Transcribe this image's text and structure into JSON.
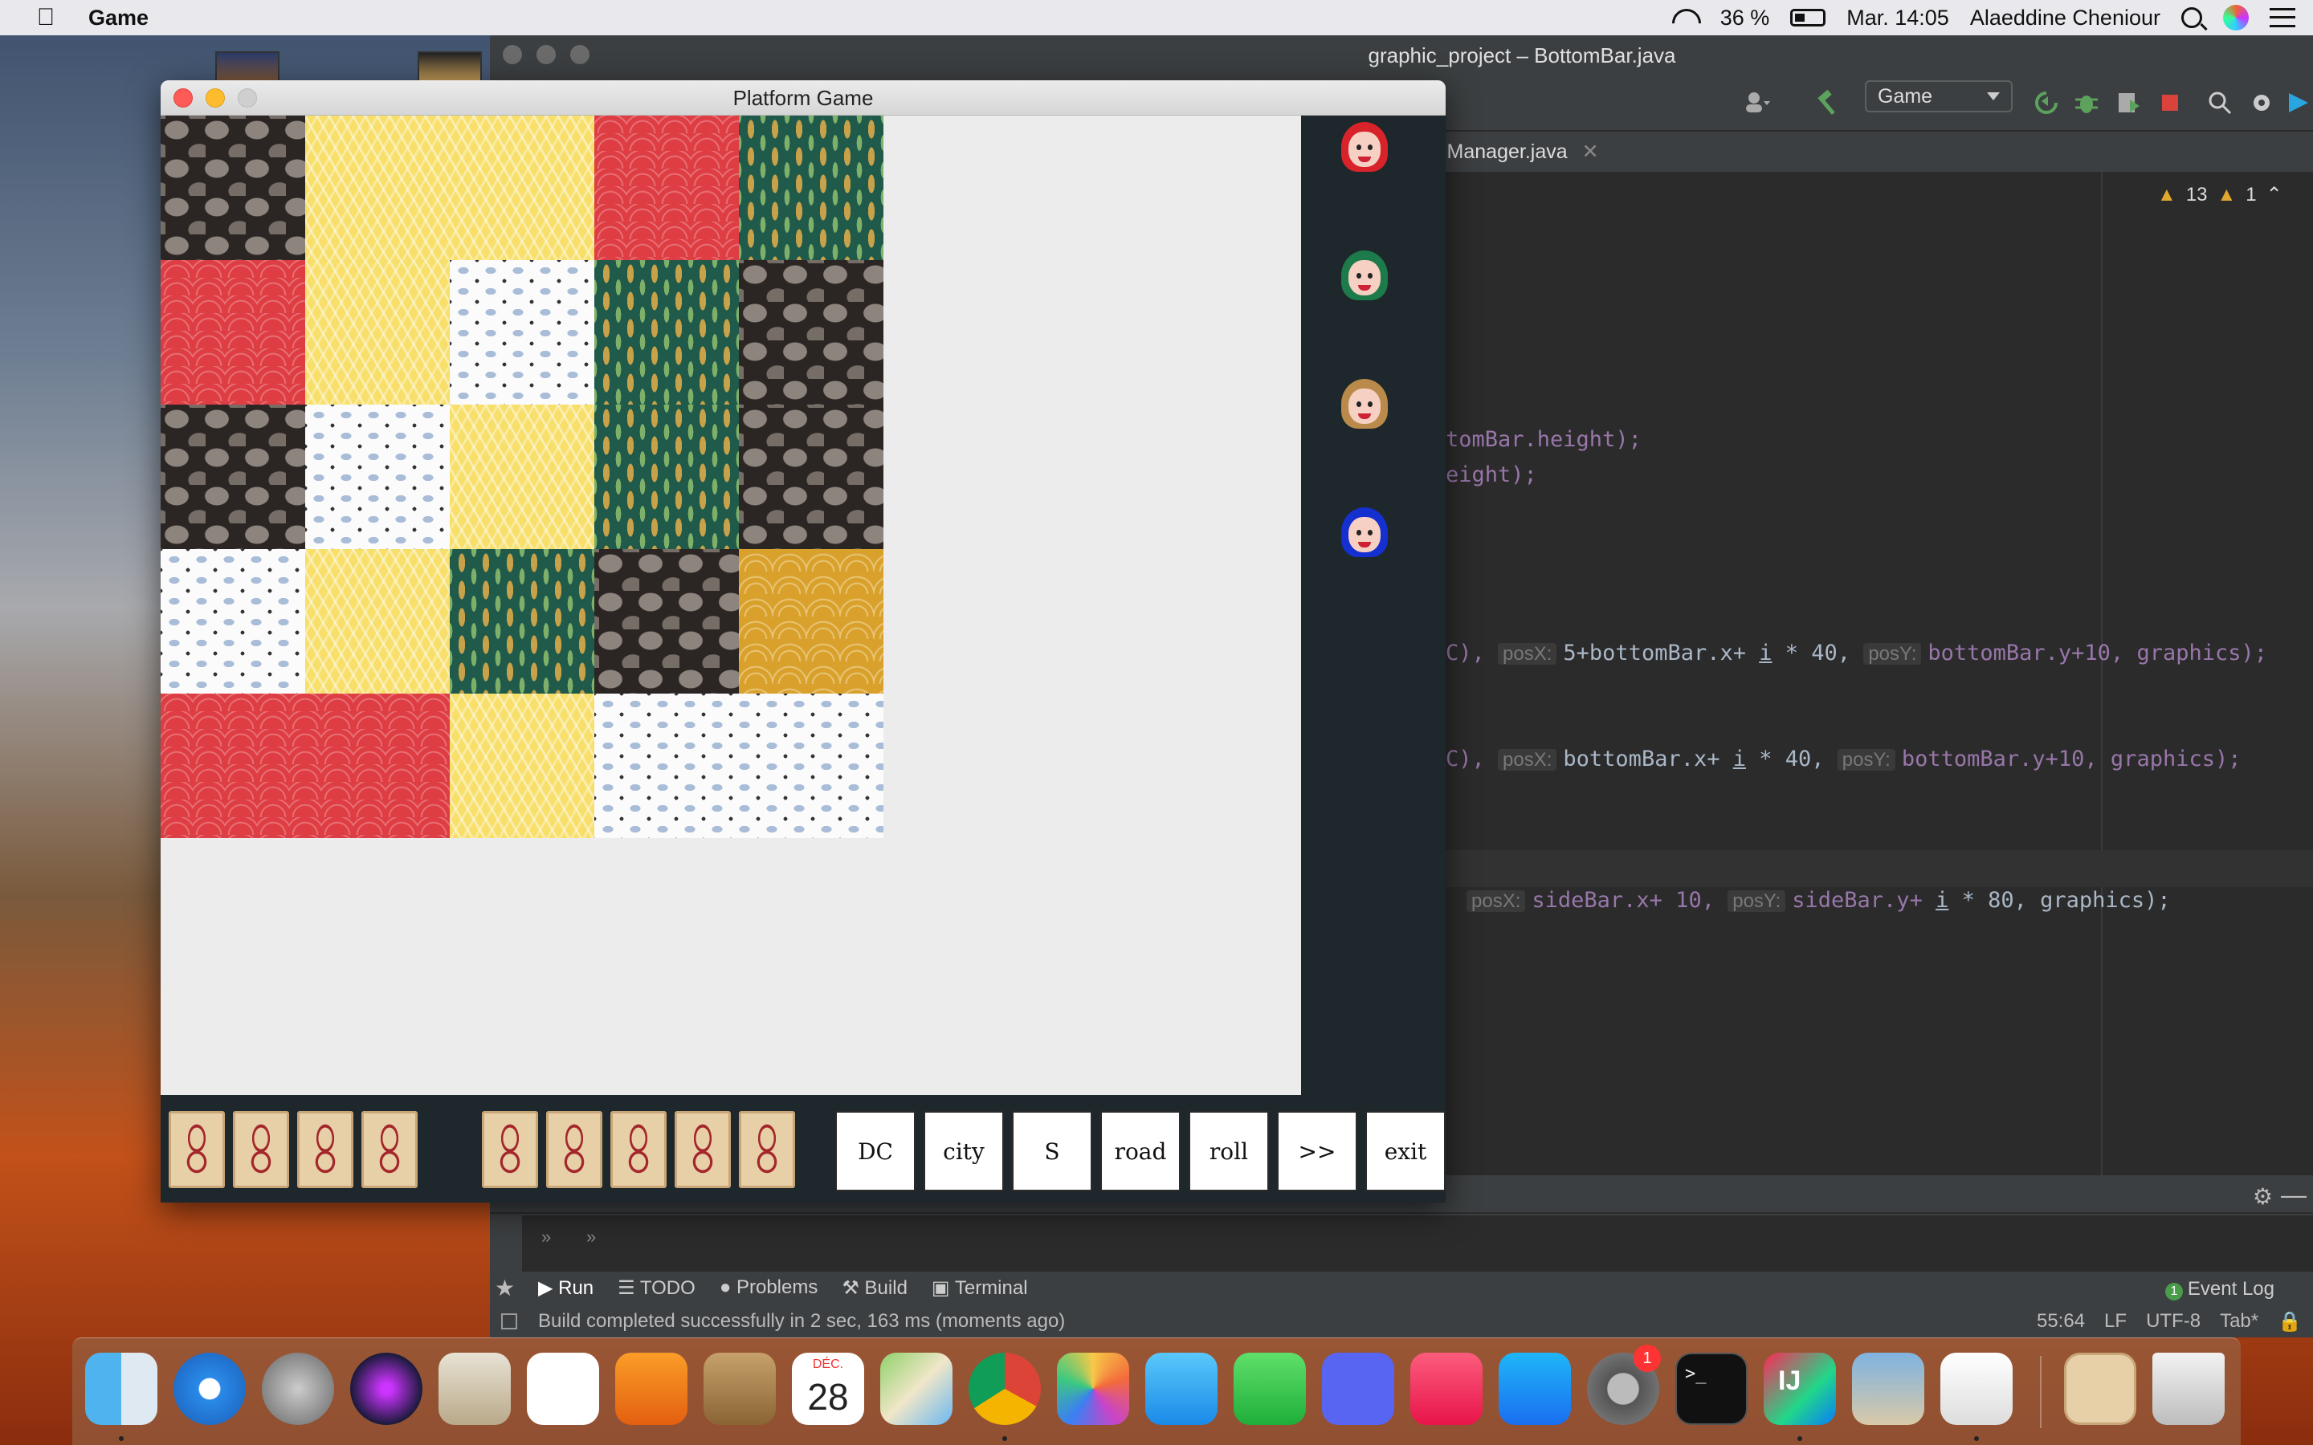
{
  "menubar": {
    "apple": "",
    "app_name": "Game",
    "battery": "36 %",
    "clock": "Mar. 14:05",
    "user": "Alaeddine Cheniour"
  },
  "ide": {
    "title": "graphic_project – BottomBar.java",
    "run_config": "Game",
    "file_tab": "lManager.java",
    "warnings": "13",
    "weak_warnings": "1",
    "code": {
      "line1": "tomBar.height);",
      "line2": "eight);",
      "line3_a": "C), ",
      "line3_hx": "posX:",
      "line3_b": "5+bottomBar.x+ ",
      "line3_i": "i",
      "line3_c": " * 40, ",
      "line3_hy": "posY:",
      "line3_d": "bottomBar.y+10, graphics);",
      "line4_a": "C), ",
      "line4_hx": "posX:",
      "line4_b": "bottomBar.x+ ",
      "line4_i": "i",
      "line4_c": " * 40, ",
      "line4_hy": "posY:",
      "line4_d": "bottomBar.y+10, graphics);",
      "line5_hx": "posX:",
      "line5_b": "sideBar.x+ 10, ",
      "line5_hy": "posY:",
      "line5_c": "sideBar.y+ ",
      "line5_i": "i",
      "line5_d": " * 80, graphics);"
    },
    "tool_tabs": [
      "Run",
      "TODO",
      "Problems",
      "Build",
      "Terminal"
    ],
    "event_log": "Event Log",
    "event_log_count": "1",
    "status_message": "Build completed successfully in 2 sec, 163 ms (moments ago)",
    "status_info": [
      "55:64",
      "LF",
      "UTF-8",
      "Tab*"
    ]
  },
  "game": {
    "title": "Platform Game",
    "buttons": [
      "DC",
      "city",
      "S",
      "road",
      "roll",
      ">>",
      "exit"
    ],
    "players": [
      {
        "hair": "#d8232a"
      },
      {
        "hair": "#1d7a4a"
      },
      {
        "hair": "#b98a4a"
      },
      {
        "hair": "#1530d0"
      }
    ],
    "colors": {
      "stone": "#2b2624",
      "red": "#de3d43",
      "yellow": "#f7df6a",
      "green": "#1f5a4a",
      "white": "#fbfbfb",
      "ochre": "#d9a12c",
      "panel": "#1e272b"
    }
  },
  "dock": {
    "calendar_month": "DÉC.",
    "calendar_day": "28",
    "terminal_prompt": ">_",
    "intellij_label": "IJ",
    "prefs_badge": "1"
  }
}
